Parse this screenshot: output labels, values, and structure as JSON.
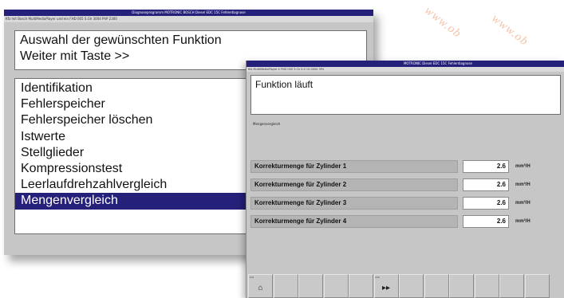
{
  "watermark": {
    "text": "www.ob"
  },
  "back_window": {
    "title": "Diagnoseprogramm MOTRONIC BOSCH Diesel EDC 15C Fehlerdiagnose",
    "info": "Kfz mit Bosch MultiMediaPlayer und ein FHD 005 S.Gh 3004 PhP 2300",
    "header_line1": "Auswahl der gewünschten Funktion",
    "header_line2": "Weiter mit Taste >>",
    "menu_items": [
      "Identifikation",
      "Fehlerspeicher",
      "Fehlerspeicher löschen",
      "Istwerte",
      "Stellglieder",
      "Kompressionstest",
      "Leerlaufdrehzahlvergleich",
      "Mengenvergleich"
    ],
    "selected_index": 7
  },
  "front_window": {
    "title": "MOTRONIC Diesel EDC 15C Fehlerdiagnose",
    "info": "Kfz MultiMediaPlayer 4 FHD 005 3.Ch S.0 10.0000 3P4",
    "status_text": "Funktion läuft",
    "section_label": "Mengenvergleich",
    "rows": [
      {
        "label": "Korrekturmenge für Zylinder 1",
        "value": "2.6",
        "unit": "mm³/H"
      },
      {
        "label": "Korrekturmenge für Zylinder 2",
        "value": "2.6",
        "unit": "mm³/H"
      },
      {
        "label": "Korrekturmenge für Zylinder 3",
        "value": "2.6",
        "unit": "mm³/H"
      },
      {
        "label": "Korrekturmenge für Zylinder 4",
        "value": "2.6",
        "unit": "mm³/H"
      }
    ],
    "function_keys": [
      {
        "label": "Fn1",
        "icon": "home-icon",
        "glyph": "⌂"
      },
      {
        "label": "",
        "icon": "",
        "glyph": ""
      },
      {
        "label": "",
        "icon": "",
        "glyph": ""
      },
      {
        "label": "",
        "icon": "",
        "glyph": ""
      },
      {
        "label": "",
        "icon": "",
        "glyph": ""
      },
      {
        "label": "Fn6",
        "icon": "fast-forward-icon",
        "glyph": "▸▸"
      },
      {
        "label": "",
        "icon": "",
        "glyph": ""
      },
      {
        "label": "",
        "icon": "",
        "glyph": ""
      },
      {
        "label": "",
        "icon": "",
        "glyph": ""
      },
      {
        "label": "",
        "icon": "",
        "glyph": ""
      },
      {
        "label": "",
        "icon": "",
        "glyph": ""
      },
      {
        "label": "",
        "icon": "",
        "glyph": ""
      },
      {
        "label": "",
        "icon": "",
        "glyph": ""
      }
    ]
  },
  "colors": {
    "titlebar": "#25207a",
    "selection": "#25207a",
    "window_bg": "#c6c6c6",
    "watermark": "#f2c2a8"
  }
}
